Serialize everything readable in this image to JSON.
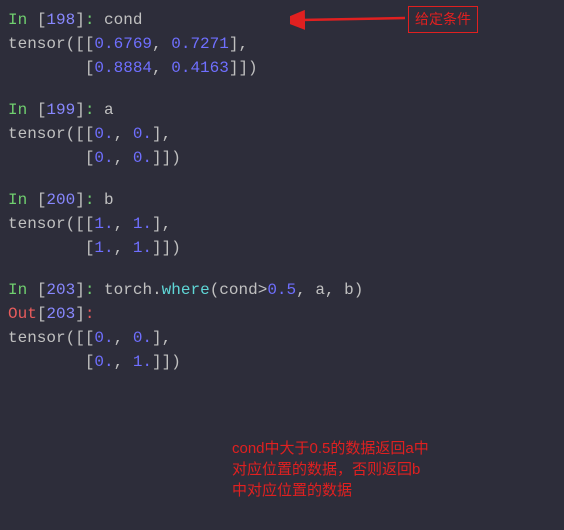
{
  "cells": [
    {
      "in_prompt": "In ",
      "idx": "198",
      "input_var": "cond",
      "output_lines": [
        "tensor([[0.6769, 0.7271],",
        "        [0.8884, 0.4163]])"
      ]
    },
    {
      "in_prompt": "In ",
      "idx": "199",
      "input_var": "a",
      "output_lines": [
        "tensor([[0., 0.],",
        "        [0., 0.]])"
      ]
    },
    {
      "in_prompt": "In ",
      "idx": "200",
      "input_var": "b",
      "output_lines": [
        "tensor([[1., 1.],",
        "        [1., 1.]])"
      ]
    },
    {
      "in_prompt": "In ",
      "idx": "203",
      "input_expr": {
        "prefix": "torch",
        "method": "where",
        "args_parts": [
          "cond",
          ">",
          "0.5",
          ", a, b"
        ]
      },
      "out_prompt": "Out",
      "output_lines": [
        "tensor([[0., 0.],",
        "        [0., 1.]])"
      ]
    }
  ],
  "annotations": {
    "top_box": "给定条件",
    "bottom_line1": "cond中大于0.5的数据返回a中",
    "bottom_line2": "对应位置的数据，否则返回b",
    "bottom_line3": "中对应位置的数据"
  },
  "chart_data": {
    "type": "table",
    "title": "torch.where demonstration",
    "tensors": {
      "cond": [
        [
          0.6769,
          0.7271
        ],
        [
          0.8884,
          0.4163
        ]
      ],
      "a": [
        [
          0.0,
          0.0
        ],
        [
          0.0,
          0.0
        ]
      ],
      "b": [
        [
          1.0,
          1.0
        ],
        [
          1.0,
          1.0
        ]
      ],
      "result": [
        [
          0.0,
          0.0
        ],
        [
          0.0,
          1.0
        ]
      ]
    },
    "expression": "torch.where(cond>0.5, a, b)"
  }
}
